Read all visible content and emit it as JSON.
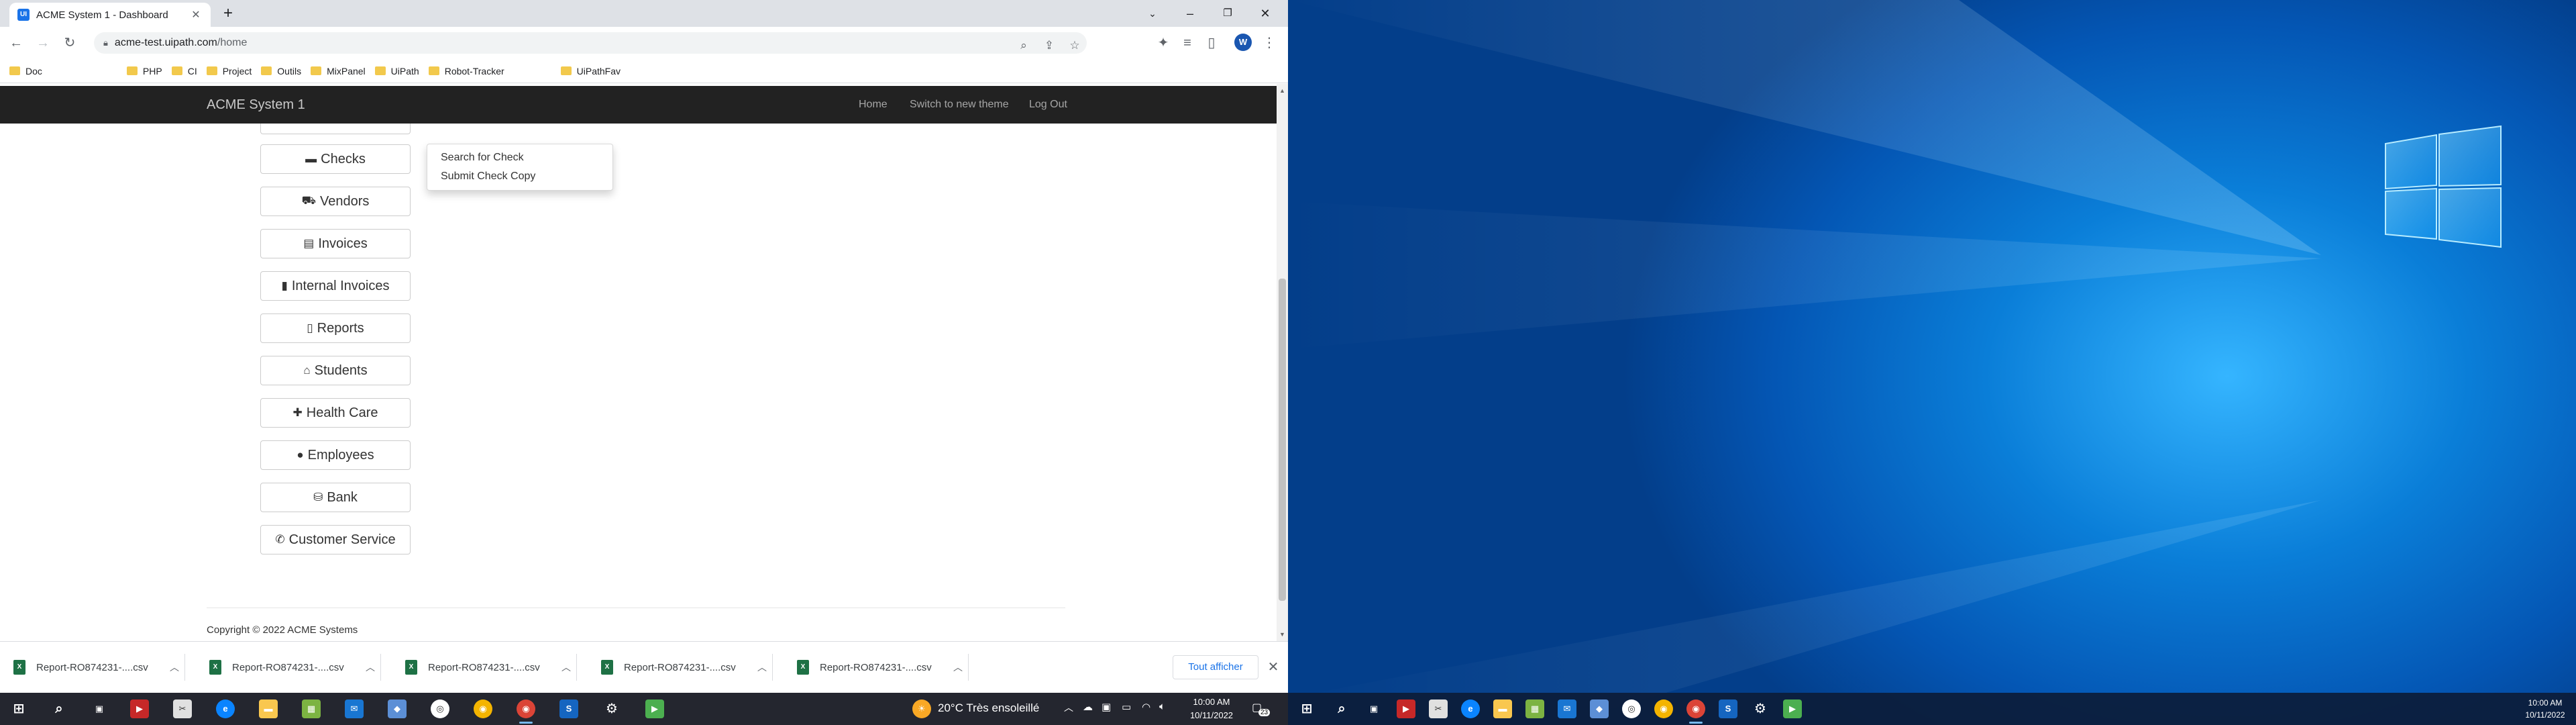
{
  "browser": {
    "tab_title": "ACME System 1 - Dashboard",
    "tab_icon_text": "UI",
    "url_host": "acme-test.uipath.com",
    "url_path": "/home",
    "avatar_initial": "W",
    "bookmarks": [
      "Doc",
      "PHP",
      "CI",
      "Project",
      "Outils",
      "MixPanel",
      "UiPath",
      "Robot-Tracker",
      "UiPathFav"
    ]
  },
  "app": {
    "brand": "ACME System 1",
    "nav": {
      "home": "Home",
      "theme": "Switch to new theme",
      "logout": "Log Out"
    },
    "menu": [
      {
        "label": "Checks",
        "icon": "credit-card-icon",
        "glyph": "▬"
      },
      {
        "label": "Vendors",
        "icon": "truck-icon",
        "glyph": "⛟"
      },
      {
        "label": "Invoices",
        "icon": "file-icon",
        "glyph": "▤"
      },
      {
        "label": "Internal Invoices",
        "icon": "file-text-icon",
        "glyph": "▮"
      },
      {
        "label": "Reports",
        "icon": "file-outline-icon",
        "glyph": "▯"
      },
      {
        "label": "Students",
        "icon": "graduation-cap-icon",
        "glyph": "⌂"
      },
      {
        "label": "Health Care",
        "icon": "medkit-icon",
        "glyph": "✚"
      },
      {
        "label": "Employees",
        "icon": "user-icon",
        "glyph": "●"
      },
      {
        "label": "Bank",
        "icon": "piggy-bank-icon",
        "glyph": "⛁"
      },
      {
        "label": "Customer Service",
        "icon": "phone-icon",
        "glyph": "✆"
      }
    ],
    "dropdown": [
      "Search for Check",
      "Submit Check Copy"
    ],
    "copyright": "Copyright © 2022 ACME Systems"
  },
  "downloads": {
    "files": [
      "Report-RO874231-....csv",
      "Report-RO874231-....csv",
      "Report-RO874231-....csv",
      "Report-RO874231-....csv",
      "Report-RO874231-....csv"
    ],
    "show_all": "Tout afficher"
  },
  "taskbar_left": {
    "weather": "20°C  Très ensoleillé",
    "time": "10:00 AM",
    "date": "10/11/2022",
    "notifications": "23"
  },
  "taskbar_right": {
    "time": "10:00 AM",
    "date": "10/11/2022"
  },
  "colors": {
    "navbar": "#222222",
    "desktop_blue": "#0a7ed8",
    "link": "#1a73e8"
  }
}
